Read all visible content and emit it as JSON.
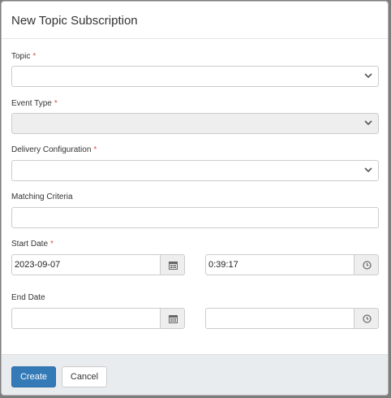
{
  "dialog": {
    "title": "New Topic Subscription"
  },
  "fields": {
    "topic": {
      "label": "Topic",
      "required": "*",
      "value": ""
    },
    "event_type": {
      "label": "Event Type",
      "required": "*",
      "value": ""
    },
    "delivery_configuration": {
      "label": "Delivery Configuration",
      "required": "*",
      "value": ""
    },
    "matching_criteria": {
      "label": "Matching Criteria",
      "value": ""
    },
    "start_date": {
      "label": "Start Date",
      "required": "*",
      "date": "2023-09-07",
      "time": "0:39:17"
    },
    "end_date": {
      "label": "End Date",
      "date": "",
      "time": ""
    }
  },
  "footer": {
    "create_label": "Create",
    "cancel_label": "Cancel"
  },
  "colors": {
    "primary": "#337ab7",
    "required": "#d9534f",
    "disabled": "#eeeeee",
    "footer_bg": "#e9ecef"
  },
  "icons": {
    "select": "chevron-down-icon",
    "date": "calendar-icon",
    "time": "clock-icon"
  }
}
